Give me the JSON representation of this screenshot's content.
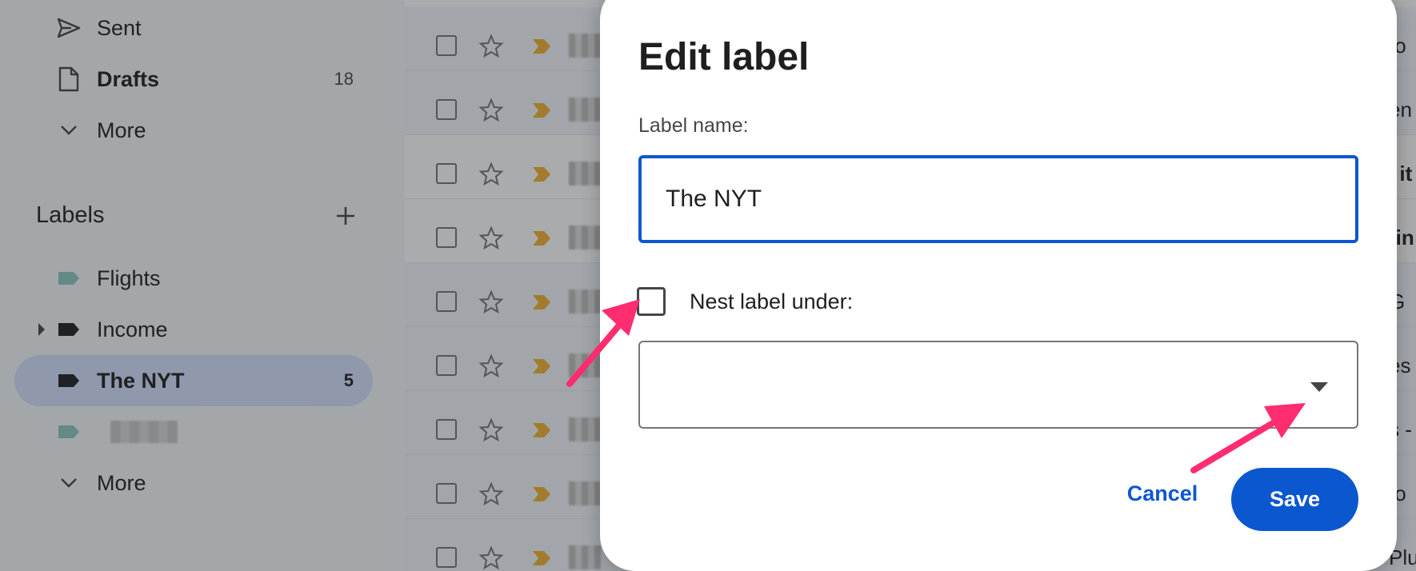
{
  "sidebar": {
    "items": [
      {
        "label": "Sent",
        "count": "",
        "icon": "send-icon"
      },
      {
        "label": "Drafts",
        "count": "18",
        "icon": "draft-icon"
      },
      {
        "label": "More",
        "count": "",
        "icon": "chevron-down-icon"
      }
    ],
    "labels_heading": "Labels",
    "labels": [
      {
        "label": "Flights",
        "count": "",
        "color": "#8fc8c4"
      },
      {
        "label": "Income",
        "count": "",
        "color": "#202124"
      },
      {
        "label": "The NYT",
        "count": "5",
        "color": "#202124",
        "active": true
      },
      {
        "label": "",
        "count": "",
        "color": "#8fc8c4",
        "blurred": true
      }
    ],
    "labels_more": "More"
  },
  "email_list": {
    "snippets": [
      "to",
      "en",
      "' it",
      "tin",
      "G",
      "es",
      "s -",
      "to",
      "Plus"
    ]
  },
  "dialog": {
    "title": "Edit label",
    "name_label": "Label name:",
    "name_value": "The NYT",
    "nest_label": "Nest label under:",
    "nest_checked": false,
    "nest_value": "",
    "cancel_label": "Cancel",
    "save_label": "Save"
  },
  "colors": {
    "accent": "#0b57d0",
    "annotation_arrow": "#ff2d6f",
    "important_marker": "#f2b233"
  }
}
